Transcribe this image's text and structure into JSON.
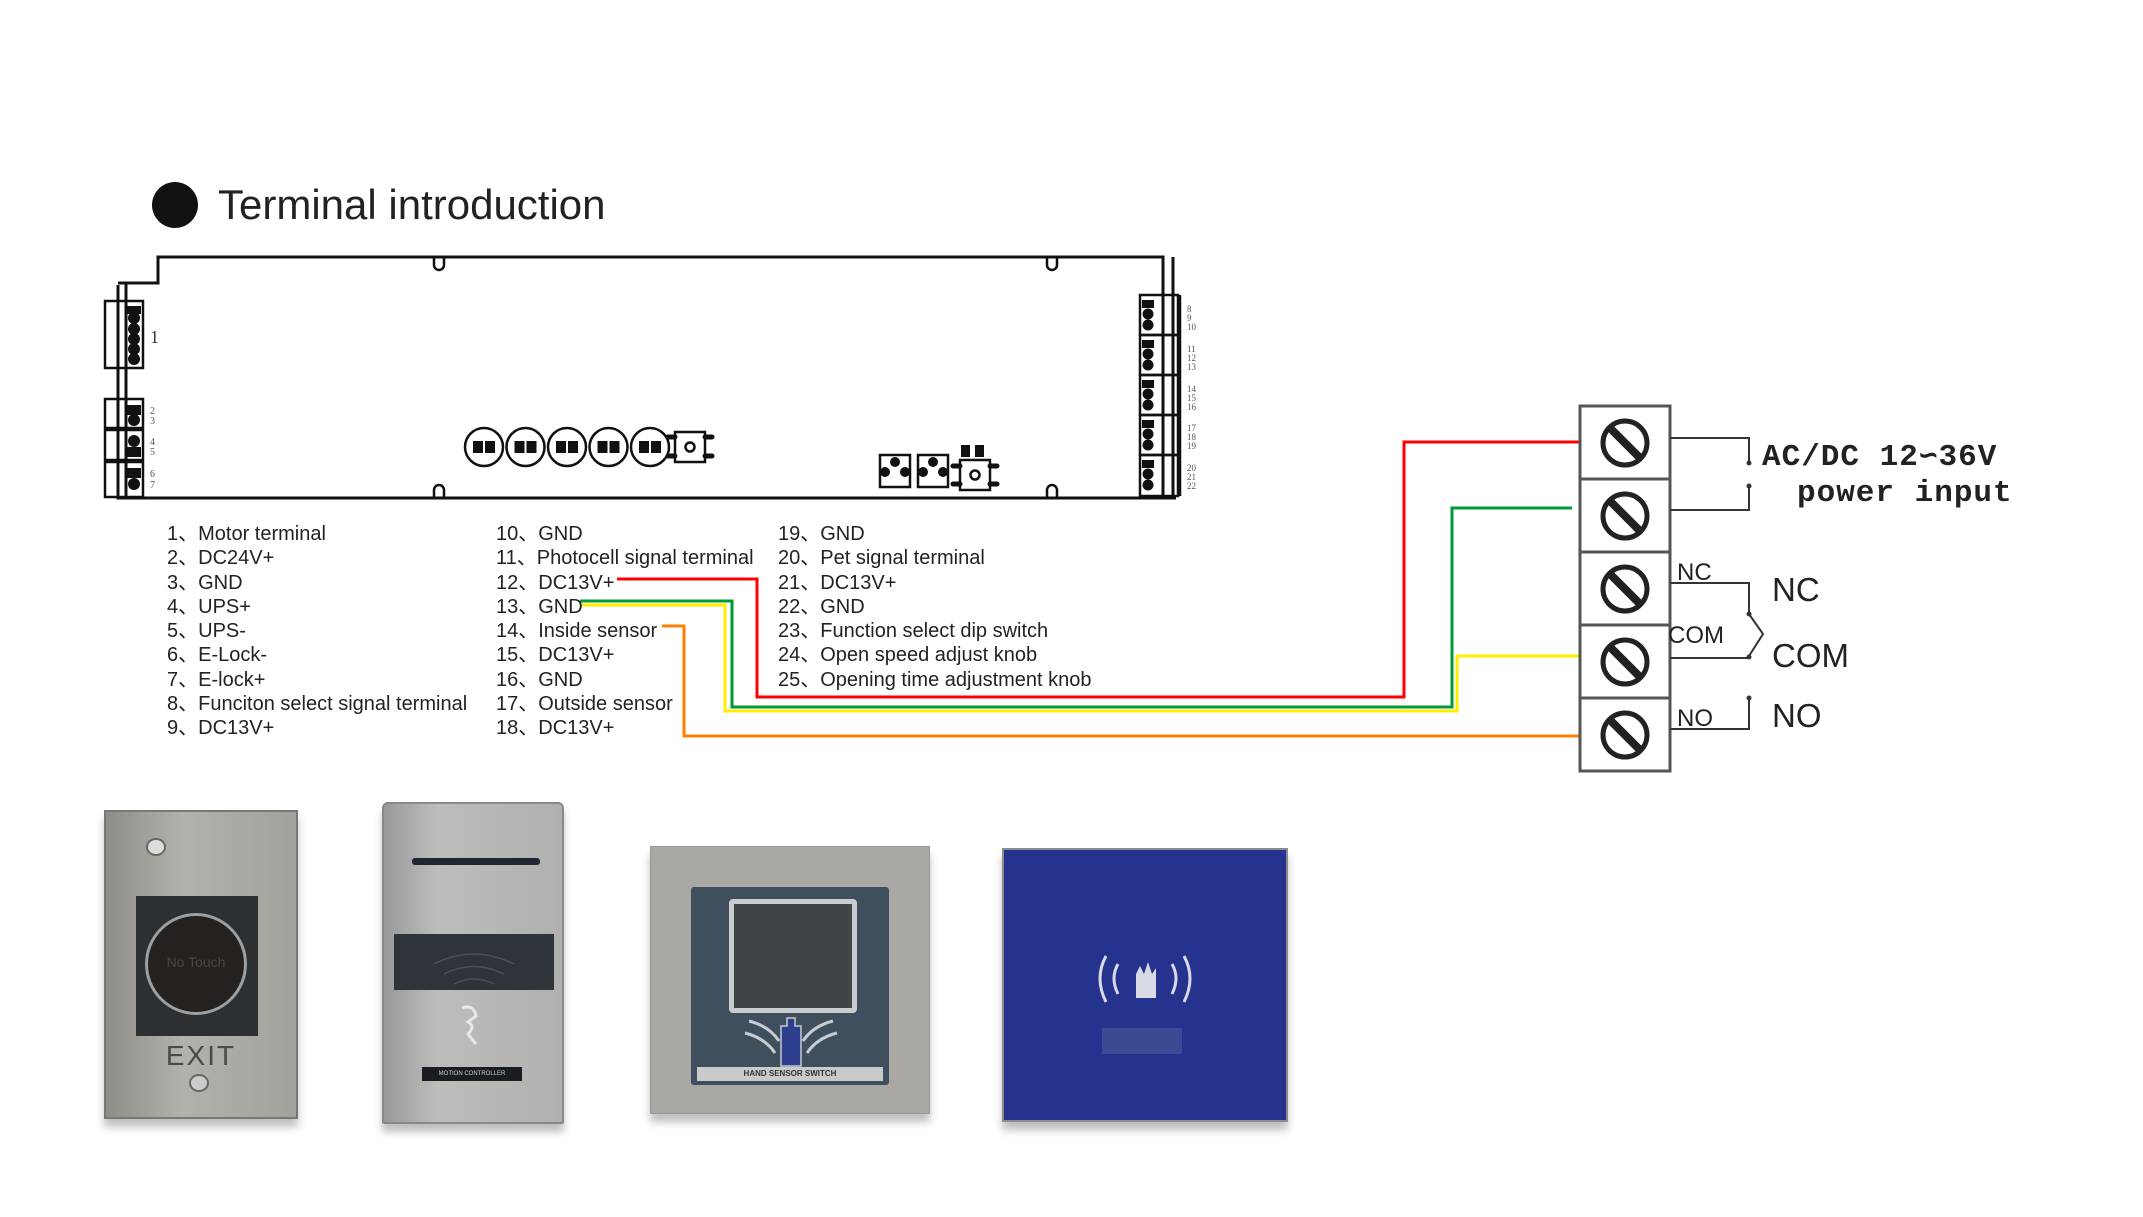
{
  "header": {
    "title": "Terminal introduction"
  },
  "board": {
    "left_labels": {
      "motor": "1",
      "pins_2_7": [
        "2",
        "3",
        "4",
        "5",
        "6",
        "7"
      ]
    },
    "right_labels": [
      "8",
      "9",
      "10",
      "11",
      "12",
      "13",
      "14",
      "15",
      "16",
      "17",
      "18",
      "19",
      "20",
      "21",
      "22"
    ]
  },
  "legend": {
    "column1": [
      {
        "num": "1、",
        "label": "Motor terminal"
      },
      {
        "num": "2、",
        "label": "DC24V+"
      },
      {
        "num": "3、",
        "label": "GND"
      },
      {
        "num": "4、",
        "label": "UPS+"
      },
      {
        "num": "5、",
        "label": "UPS-"
      },
      {
        "num": "6、",
        "label": "E-Lock-"
      },
      {
        "num": "7、",
        "label": "E-lock+"
      },
      {
        "num": "8、",
        "label": "Funciton select signal terminal"
      },
      {
        "num": "9、",
        "label": "DC13V+"
      }
    ],
    "column2": [
      {
        "num": "10、",
        "label": "GND"
      },
      {
        "num": "11、",
        "label": "Photocell signal terminal"
      },
      {
        "num": "12、",
        "label": "DC13V+"
      },
      {
        "num": "13、",
        "label": "GND"
      },
      {
        "num": "14、",
        "label": "Inside sensor"
      },
      {
        "num": "15、",
        "label": "DC13V+"
      },
      {
        "num": "16、",
        "label": "GND"
      },
      {
        "num": "17、",
        "label": "Outside sensor"
      },
      {
        "num": "18、",
        "label": "DC13V+"
      }
    ],
    "column3": [
      {
        "num": "19、",
        "label": "GND"
      },
      {
        "num": "20、",
        "label": "Pet signal terminal"
      },
      {
        "num": "21、",
        "label": "DC13V+"
      },
      {
        "num": "22、",
        "label": "GND"
      },
      {
        "num": "23、",
        "label": "Function select dip switch"
      },
      {
        "num": "24、",
        "label": "Open speed adjust knob"
      },
      {
        "num": "25、",
        "label": "Opening time adjustment  knob"
      }
    ]
  },
  "wires": [
    {
      "from": "12、DC13V+",
      "to": "terminal-1",
      "color": "#ff0000"
    },
    {
      "from": "13、GND",
      "to": "terminal-2",
      "color": "#009a3a"
    },
    {
      "from": "13、GND",
      "to": "terminal-4 (COM)",
      "color": "#ffee00"
    },
    {
      "from": "14、Inside sensor",
      "to": "terminal-5 (NO)",
      "color": "#ff8000"
    }
  ],
  "terminal_block": {
    "power_line1": "AC/DC 12∽36V",
    "power_line2": "power input",
    "small_labels": {
      "nc": "NC",
      "com": "COM",
      "no": "NO"
    },
    "relay_labels": {
      "nc": "NC",
      "com": "COM",
      "no": "NO"
    }
  },
  "devices": [
    {
      "name": "No Touch exit button",
      "text": "No Touch",
      "label": "EXIT"
    },
    {
      "name": "Microwave sensor",
      "label": "MOTION CONTROLLER"
    },
    {
      "name": "Hand sensor switch",
      "label": "HAND SENSOR SWITCH"
    },
    {
      "name": "Blue hand wave sensor"
    }
  ]
}
